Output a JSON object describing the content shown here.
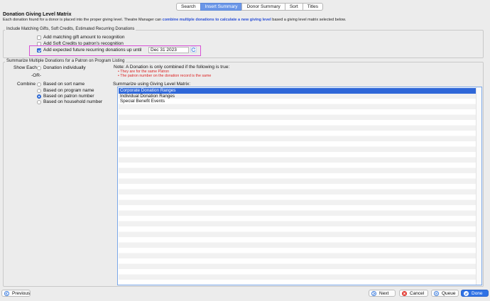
{
  "tabs": [
    {
      "label": "Search",
      "active": false
    },
    {
      "label": "Insert Summary",
      "active": true
    },
    {
      "label": "Donor Summary",
      "active": false
    },
    {
      "label": "Sort",
      "active": false
    },
    {
      "label": "Titles",
      "active": false
    }
  ],
  "header": {
    "title": "Donation  Giving Level Matrix",
    "desc_prefix": "Each donation found for a donor is placed into the proper giving level.  Theatre Manager can",
    "desc_link": "combine multiple donations to calculate a new giving level",
    "desc_suffix": "based a giving level matrix selected below."
  },
  "matching": {
    "title": "Include Matching Gifts, Soft Credits, Estimated Recurring Donations",
    "matching_gift_label": "Add matching gift amount to recognition",
    "matching_gift_checked": false,
    "soft_credits_label": "Add Soft Credits to patron's recognition",
    "soft_credits_checked": false,
    "recurring_label": "Add expected future recurring donations up until",
    "recurring_checked": true,
    "recurring_date": "Dec 31 2023"
  },
  "summarize": {
    "title": "Summarize Multiple Donations for a Patron on Program Listing",
    "show_each_label": "Show Each",
    "donation_individually_label": "Donation individually",
    "or_label": "-OR-",
    "combine_label": "Combine",
    "options": [
      {
        "label": "Based on sort name",
        "checked": false
      },
      {
        "label": "Based on program name",
        "checked": false
      },
      {
        "label": "Based on patron number",
        "checked": true
      },
      {
        "label": "Based on household number",
        "checked": false
      }
    ],
    "note_title": "Note: A Donation is only combined if the following is true:",
    "note_items": [
      "• They are for the same Patron",
      "• The patron number on the donation record is the same"
    ],
    "matrix_label": "Summarize using Giving Level Matrix:",
    "matrix_items": [
      {
        "label": "Corporate Donation Ranges",
        "selected": true
      },
      {
        "label": "Individual Donation Ranges",
        "selected": false
      },
      {
        "label": "Special Benefit Events",
        "selected": false
      }
    ]
  },
  "footer": {
    "previous": "Previous",
    "next": "Next",
    "cancel": "Cancel",
    "queue": "Queue",
    "done": "Done"
  },
  "colors": {
    "accent": "#2f72e6",
    "active_tab": "#6a96e8",
    "note_red": "#dd2222",
    "highlight": "#d850d6"
  }
}
